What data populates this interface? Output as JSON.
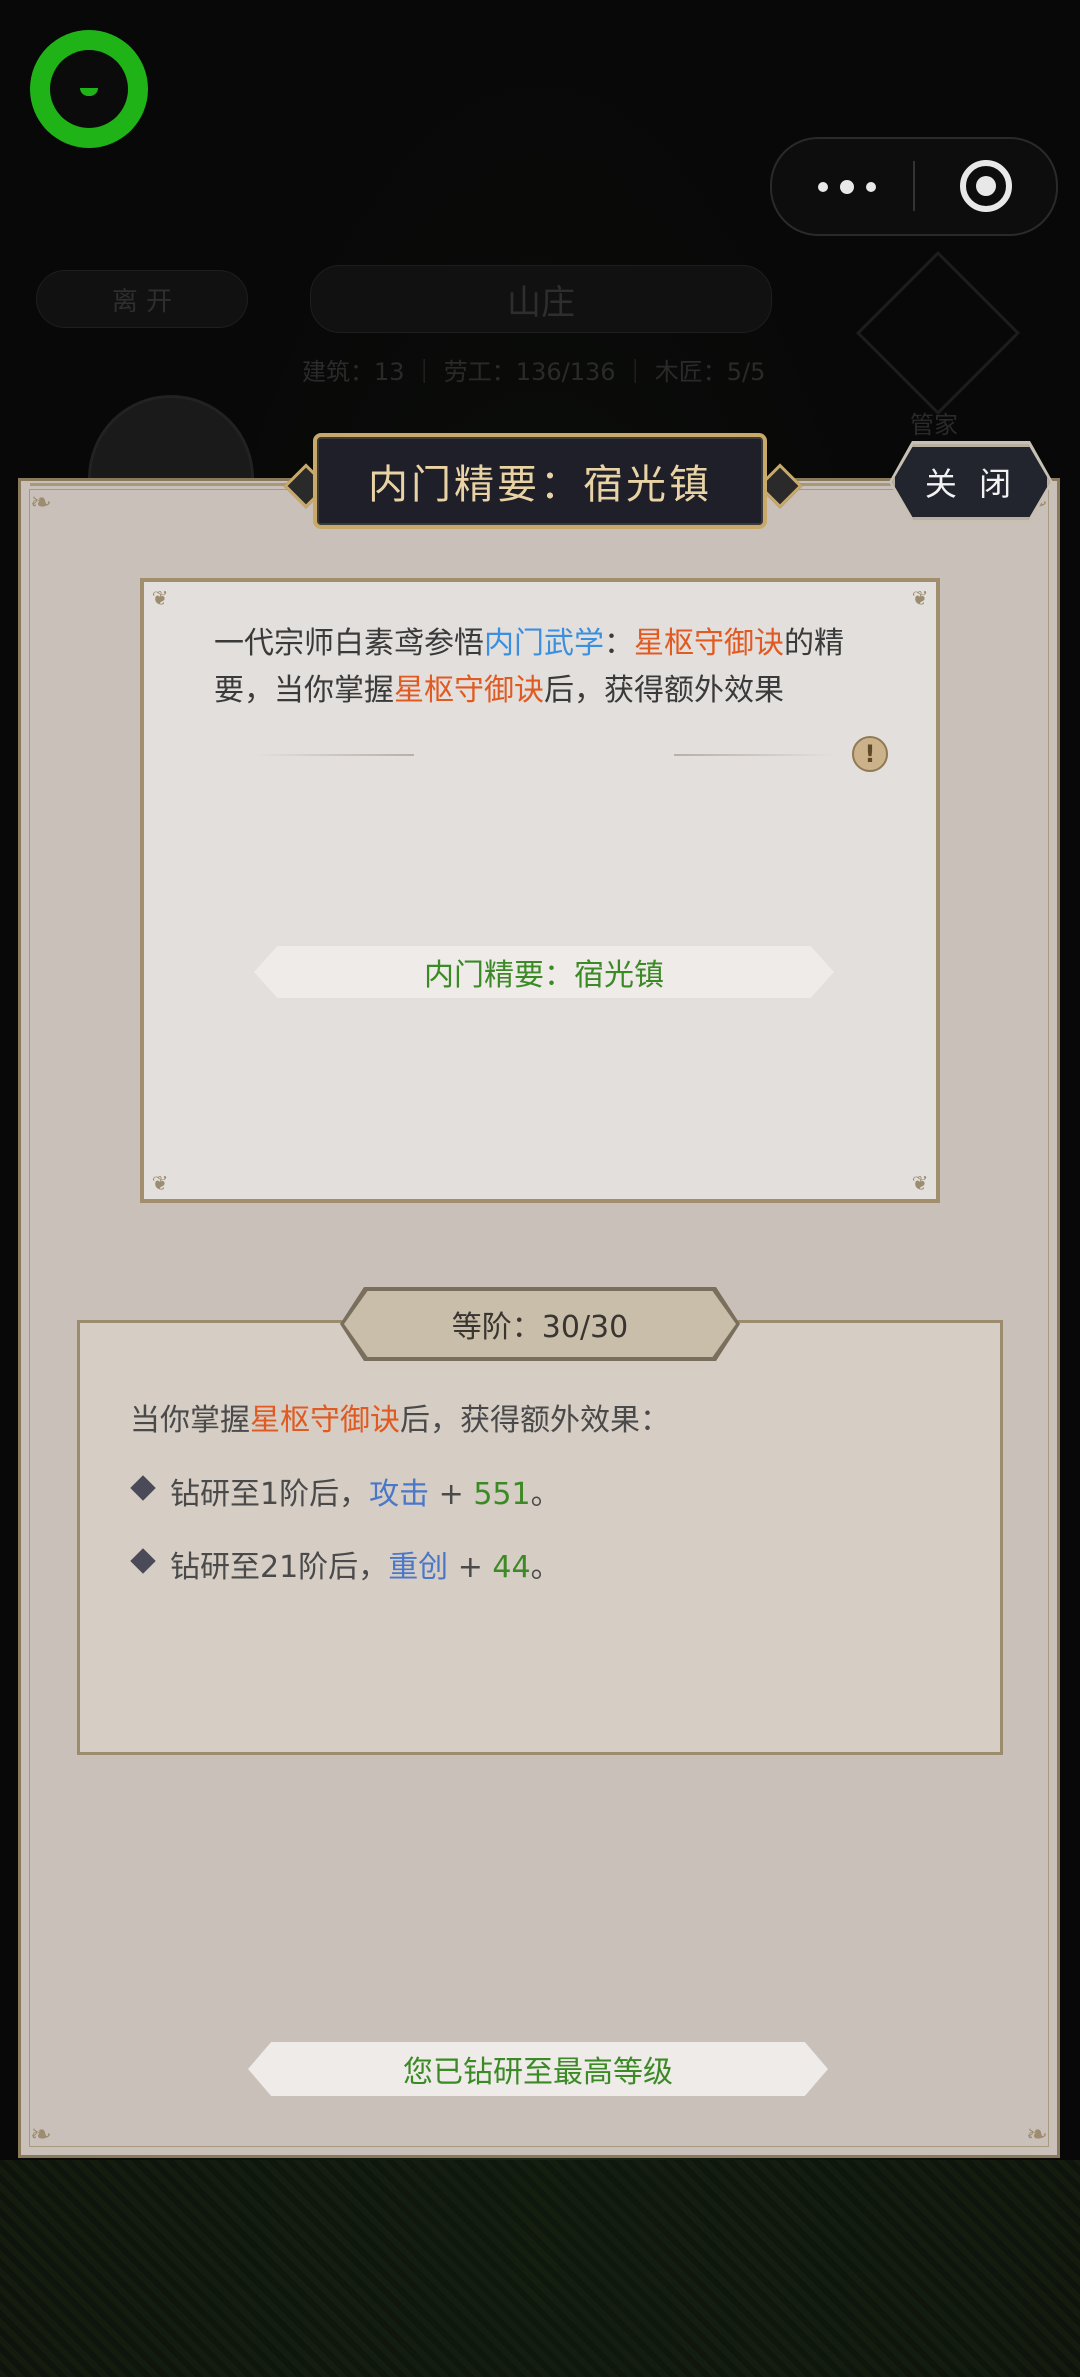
{
  "background": {
    "leave_label": "离 开",
    "area_title": "山庄",
    "stats_text": "建筑：13 ｜ 劳工：136/136 ｜ 木匠：5/5",
    "steward_label": "管家"
  },
  "dialog": {
    "title": "内门精要：宿光镇",
    "close_label": "关 闭",
    "description": {
      "part1": "一代宗师白素鸢参悟",
      "inner_art": "内门武学",
      "colon": "：",
      "skill": "星枢守御诀",
      "part2": "的精要，当你掌握",
      "skill2": "星枢守御诀",
      "part3": "后，获得额外效果"
    },
    "essence_name": "内门精要：宿光镇",
    "grade_label": "等阶：30/30",
    "effects_intro": {
      "prefix": "当你掌握",
      "skill": "星枢守御诀",
      "suffix": "后，获得额外效果："
    },
    "effects": [
      {
        "prefix": "钻研至1阶后，",
        "stat": "攻击",
        "plus": " + ",
        "value": "551",
        "end": "。"
      },
      {
        "prefix": "钻研至21阶后，",
        "stat": "重创",
        "plus": " + ",
        "value": "44",
        "end": "。"
      }
    ],
    "max_level_text": "您已钻研至最高等级"
  },
  "colors": {
    "accent_gold": "#c8a96a",
    "highlight_blue": "#3b8fe0",
    "highlight_orange": "#e05a22",
    "value_green": "#3c8a26",
    "logo_green": "#1fb318"
  },
  "icons": [
    "miniprogram-logo-icon",
    "more-dots-icon",
    "record-target-icon",
    "info-icon",
    "diamond-bullet-icon"
  ]
}
